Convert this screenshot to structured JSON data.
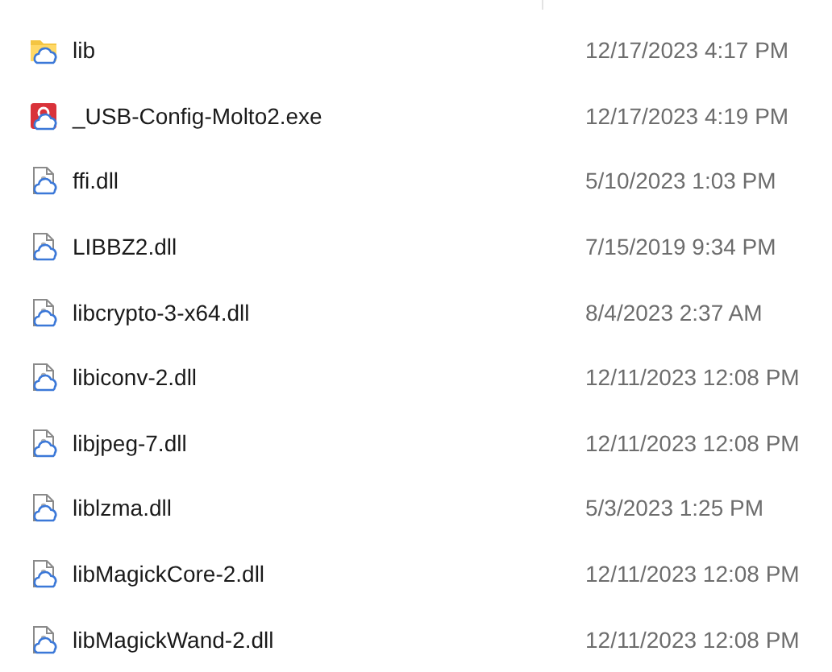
{
  "files": [
    {
      "kind": "folder",
      "name": "lib",
      "date_modified": "12/17/2023 4:17 PM"
    },
    {
      "kind": "exe",
      "name": "_USB-Config-Molto2.exe",
      "date_modified": "12/17/2023 4:19 PM"
    },
    {
      "kind": "dll",
      "name": "ffi.dll",
      "date_modified": "5/10/2023 1:03 PM"
    },
    {
      "kind": "dll",
      "name": "LIBBZ2.dll",
      "date_modified": "7/15/2019 9:34 PM"
    },
    {
      "kind": "dll",
      "name": "libcrypto-3-x64.dll",
      "date_modified": "8/4/2023 2:37 AM"
    },
    {
      "kind": "dll",
      "name": "libiconv-2.dll",
      "date_modified": "12/11/2023 12:08 PM"
    },
    {
      "kind": "dll",
      "name": "libjpeg-7.dll",
      "date_modified": "12/11/2023 12:08 PM"
    },
    {
      "kind": "dll",
      "name": "liblzma.dll",
      "date_modified": "5/3/2023 1:25 PM"
    },
    {
      "kind": "dll",
      "name": "libMagickCore-2.dll",
      "date_modified": "12/11/2023 12:08 PM"
    },
    {
      "kind": "dll",
      "name": "libMagickWand-2.dll",
      "date_modified": "12/11/2023 12:08 PM"
    }
  ]
}
